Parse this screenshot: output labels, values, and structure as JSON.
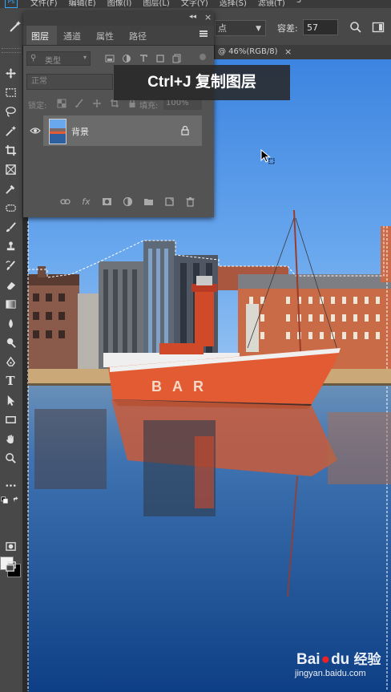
{
  "menubar": {
    "items": [
      "文件(F)",
      "编辑(E)",
      "图像(I)",
      "图层(L)",
      "文字(Y)",
      "选择(S)",
      "滤镜(T)",
      "3"
    ]
  },
  "options": {
    "sample_value": "点",
    "tolerance_label": "容差:",
    "tolerance_value": "57"
  },
  "document": {
    "tab_title": "@ 46%(RGB/8)",
    "close": "×"
  },
  "layers_panel": {
    "tabs": [
      "图层",
      "通道",
      "属性",
      "路径"
    ],
    "filter_label": "类型",
    "blend_mode": "正常",
    "lock_label": "锁定:",
    "fill_label": "填充:",
    "fill_value": "100%",
    "layer_name": "背景"
  },
  "caption": {
    "text": "Ctrl+J 复制图层"
  },
  "watermark": {
    "brand": "Bai",
    "brand_suffix": "du",
    "product": "经验",
    "url": "jingyan.baidu.com"
  },
  "icons": {
    "accent": "#31a8ff",
    "highlight": "#e04030"
  }
}
